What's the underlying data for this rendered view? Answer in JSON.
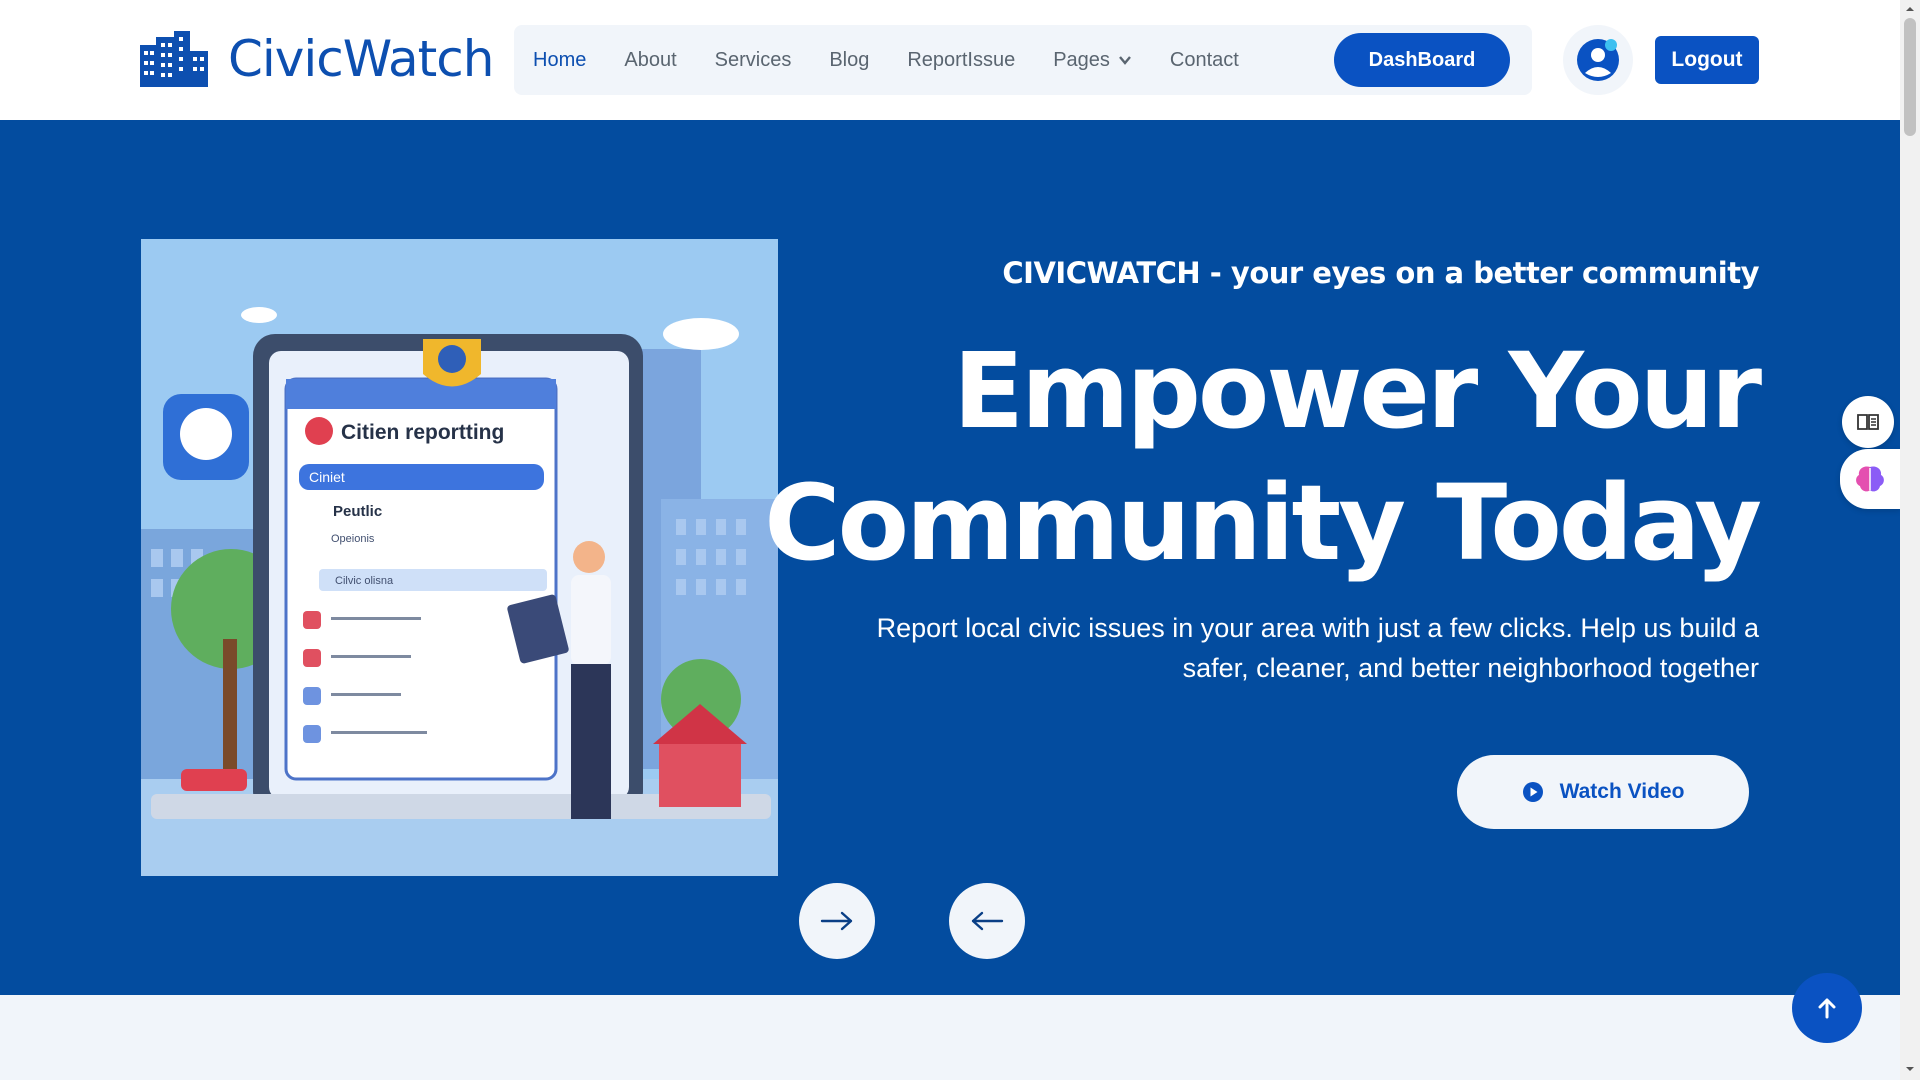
{
  "brand": {
    "name": "CivicWatch"
  },
  "nav": {
    "items": [
      {
        "label": "Home",
        "active": true
      },
      {
        "label": "About"
      },
      {
        "label": "Services"
      },
      {
        "label": "Blog"
      },
      {
        "label": "ReportIssue"
      },
      {
        "label": "Pages",
        "has_dropdown": true
      },
      {
        "label": "Contact"
      }
    ],
    "dashboard_label": "DashBoard",
    "logout_label": "Logout"
  },
  "hero": {
    "subtitle": "CIVICWATCH - your eyes on a better community",
    "title_line1": "Empower Your",
    "title_line2": "Community Today",
    "description": "Report local civic issues in your area with just a few clicks. Help us build a safer, cleaner, and better neighborhood together",
    "watch_video_label": "Watch Video",
    "illustration": {
      "card_title": "Citien reportting",
      "field_label": "Ciniet",
      "item1": "Peutlic",
      "item2": "Opeionis",
      "item3": "Cilvic olisna"
    }
  },
  "colors": {
    "primary": "#0a52c2",
    "hero_bg": "#034c9f",
    "page_bg": "#f1f5fa",
    "nav_text": "#5a6570"
  },
  "icons": {
    "logo": "city-buildings-icon",
    "avatar": "user-avatar-icon",
    "next": "arrow-right-icon",
    "prev": "arrow-left-icon",
    "play": "play-circle-icon",
    "reader": "book-reader-icon",
    "ai": "brain-icon",
    "scroll_top": "arrow-up-icon"
  }
}
